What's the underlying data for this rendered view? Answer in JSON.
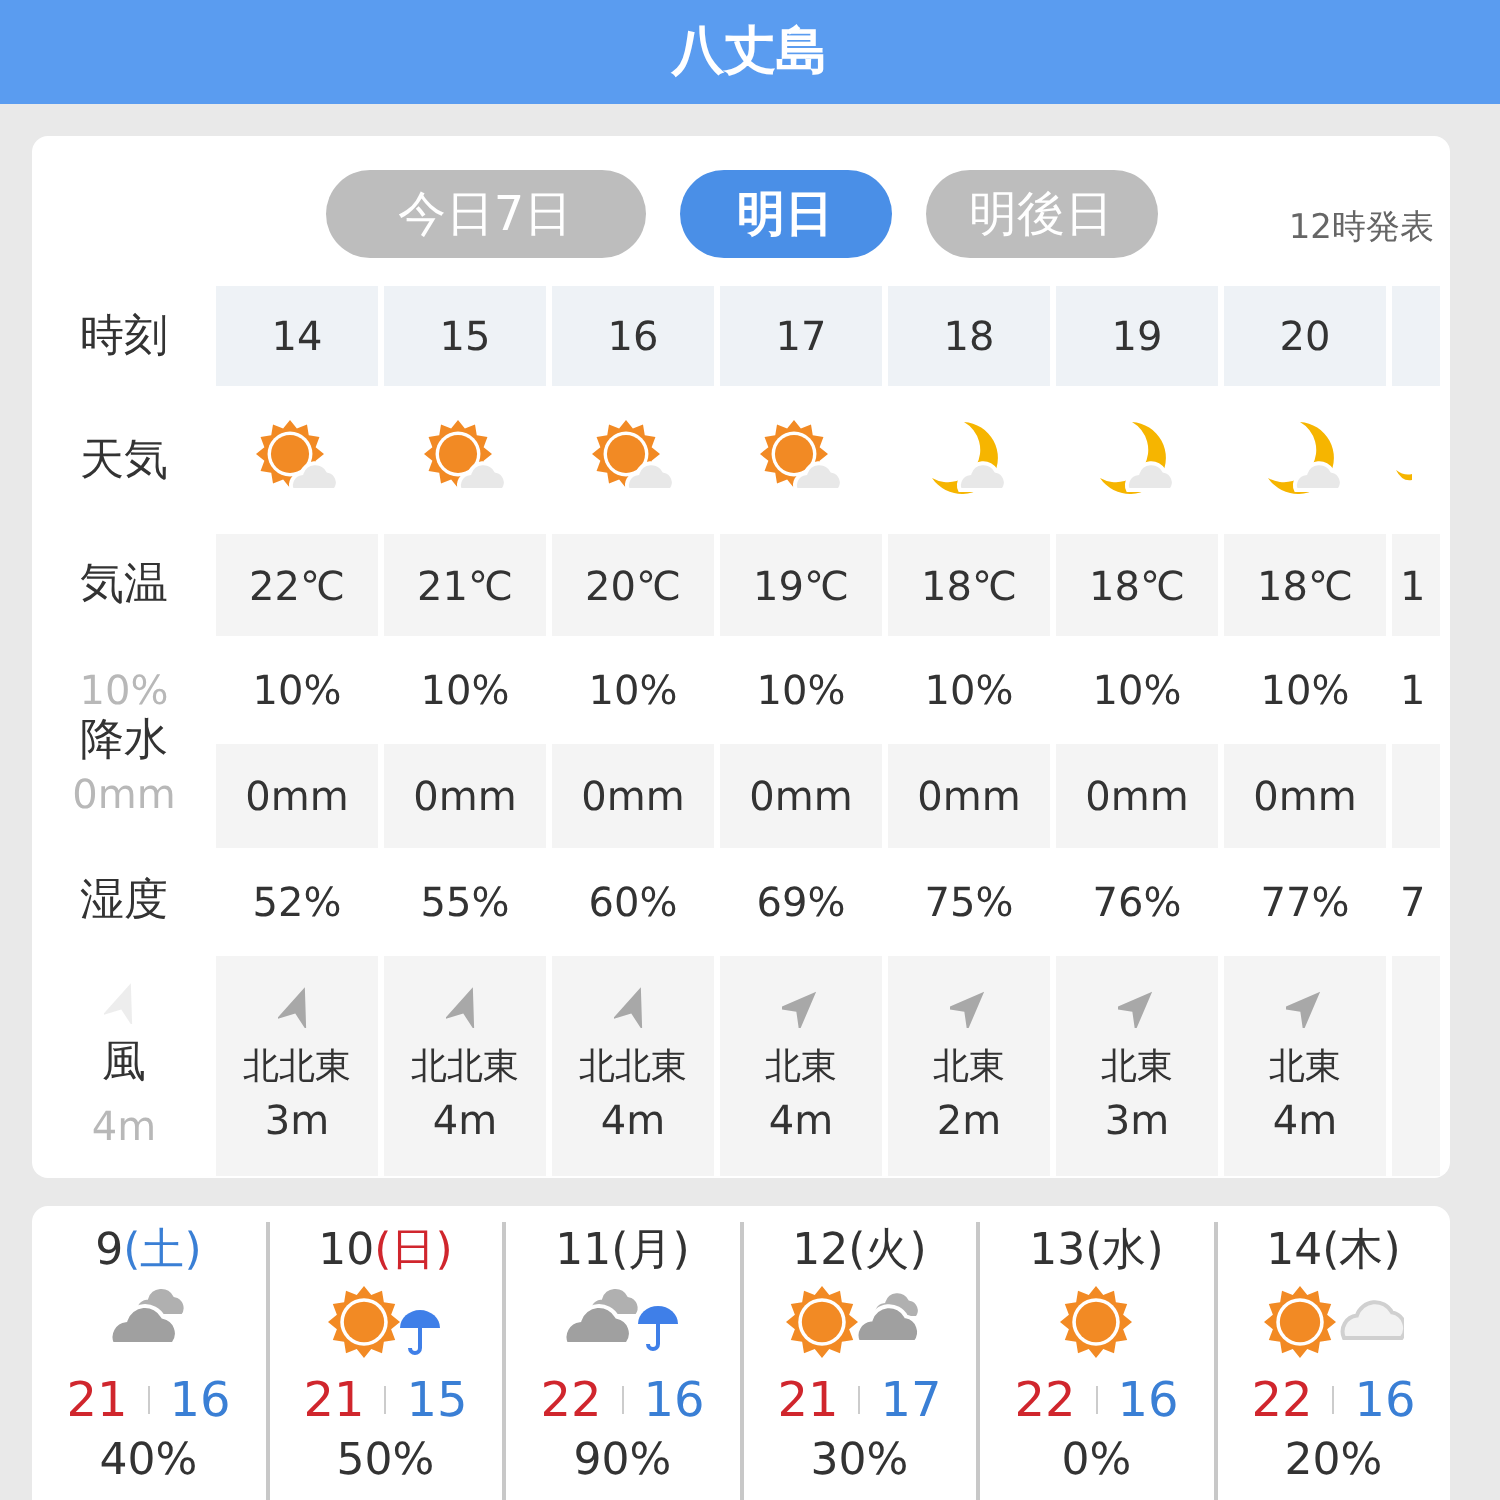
{
  "header": {
    "title": "八丈島"
  },
  "tabs": [
    {
      "label": "今日7日",
      "selected": false
    },
    {
      "label": "明日",
      "selected": true
    },
    {
      "label": "明後日",
      "selected": false
    }
  ],
  "issued": "12時発表",
  "hourly": {
    "labels": {
      "time": "時刻",
      "weather": "天気",
      "temp": "気温",
      "precip": "降水",
      "humidity": "湿度",
      "wind": "風"
    },
    "ghost": {
      "precip": "10%",
      "rain": "0mm",
      "wind_speed": "4m"
    },
    "columns": [
      {
        "time": "14",
        "weather": {
          "kind": "sun_cloud"
        },
        "temp": "22℃",
        "precip": "10%",
        "rain": "0mm",
        "humidity": "52%",
        "wind": {
          "kind": "nne",
          "direction": "北北東",
          "speed": "3m"
        }
      },
      {
        "time": "15",
        "weather": {
          "kind": "sun_cloud"
        },
        "temp": "21℃",
        "precip": "10%",
        "rain": "0mm",
        "humidity": "55%",
        "wind": {
          "kind": "nne",
          "direction": "北北東",
          "speed": "4m"
        }
      },
      {
        "time": "16",
        "weather": {
          "kind": "sun_cloud"
        },
        "temp": "20℃",
        "precip": "10%",
        "rain": "0mm",
        "humidity": "60%",
        "wind": {
          "kind": "nne",
          "direction": "北北東",
          "speed": "4m"
        }
      },
      {
        "time": "17",
        "weather": {
          "kind": "sun_cloud"
        },
        "temp": "19℃",
        "precip": "10%",
        "rain": "0mm",
        "humidity": "69%",
        "wind": {
          "kind": "ne",
          "direction": "北東",
          "speed": "4m"
        }
      },
      {
        "time": "18",
        "weather": {
          "kind": "moon_cloud"
        },
        "temp": "18℃",
        "precip": "10%",
        "rain": "0mm",
        "humidity": "75%",
        "wind": {
          "kind": "ne",
          "direction": "北東",
          "speed": "2m"
        }
      },
      {
        "time": "19",
        "weather": {
          "kind": "moon_cloud"
        },
        "temp": "18℃",
        "precip": "10%",
        "rain": "0mm",
        "humidity": "76%",
        "wind": {
          "kind": "ne",
          "direction": "北東",
          "speed": "3m"
        }
      },
      {
        "time": "20",
        "weather": {
          "kind": "moon_cloud"
        },
        "temp": "18℃",
        "precip": "10%",
        "rain": "0mm",
        "humidity": "77%",
        "wind": {
          "kind": "ne",
          "direction": "北東",
          "speed": "4m"
        }
      }
    ],
    "partial_column": {
      "weather": {
        "kind": "moon_cloud"
      },
      "temp": "1",
      "precip": "1",
      "humidity": "7"
    }
  },
  "weekly": [
    {
      "date": "9",
      "weekday": "(土)",
      "kind": "saturday",
      "weather": {
        "kind": "cloudy"
      },
      "high": "21",
      "low": "16",
      "precip": "40%"
    },
    {
      "date": "10",
      "weekday": "(日)",
      "kind": "sunday",
      "weather": {
        "kind": "sunny_rain"
      },
      "high": "21",
      "low": "15",
      "precip": "50%"
    },
    {
      "date": "11",
      "weekday": "(月)",
      "kind": "weekday",
      "weather": {
        "kind": "cloudy_rain"
      },
      "high": "22",
      "low": "16",
      "precip": "90%"
    },
    {
      "date": "12",
      "weekday": "(火)",
      "kind": "weekday",
      "weather": {
        "kind": "sunny_cloudy"
      },
      "high": "21",
      "low": "17",
      "precip": "30%"
    },
    {
      "date": "13",
      "weekday": "(水)",
      "kind": "weekday",
      "weather": {
        "kind": "sunny"
      },
      "high": "22",
      "low": "16",
      "precip": "0%"
    },
    {
      "date": "14",
      "weekday": "(木)",
      "kind": "weekday",
      "weather": {
        "kind": "sunny_fair"
      },
      "high": "22",
      "low": "16",
      "precip": "20%"
    }
  ]
}
